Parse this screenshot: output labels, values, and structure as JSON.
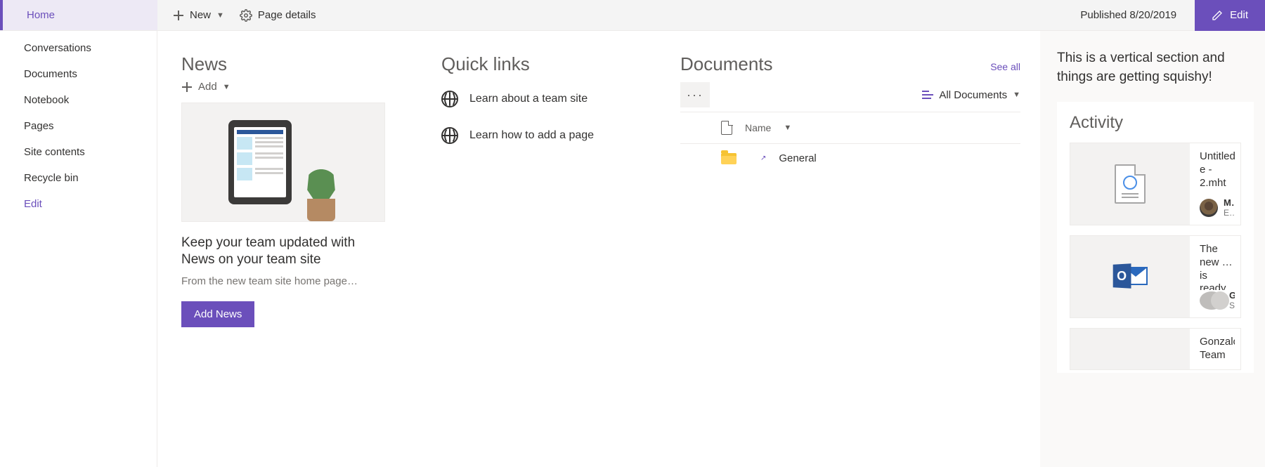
{
  "commandBar": {
    "newLabel": "New",
    "pageDetailsLabel": "Page details",
    "publishedLabel": "Published 8/20/2019",
    "editLabel": "Edit"
  },
  "leftNav": {
    "activeIndex": 0,
    "items": [
      {
        "label": "Home"
      },
      {
        "label": "Conversations"
      },
      {
        "label": "Documents"
      },
      {
        "label": "Notebook"
      },
      {
        "label": "Pages"
      },
      {
        "label": "Site contents"
      },
      {
        "label": "Recycle bin"
      },
      {
        "label": "Edit",
        "isLink": true
      }
    ]
  },
  "news": {
    "title": "News",
    "addLabel": "Add",
    "heroTitle": "Keep your team updated with News on your team site",
    "heroSubtitle": "From the new team site home page…",
    "addNewsButton": "Add News"
  },
  "quickLinks": {
    "title": "Quick links",
    "items": [
      {
        "label": "Learn about a team site"
      },
      {
        "label": "Learn how to add a page"
      }
    ]
  },
  "documents": {
    "title": "Documents",
    "seeAll": "See all",
    "viewName": "All Documents",
    "columnHeader": "Name",
    "rows": [
      {
        "name": "General",
        "type": "folder",
        "shared": true
      }
    ]
  },
  "vertical": {
    "text": "This is a vertical section and things are getting squishy!",
    "activityTitle": "Activity",
    "items": [
      {
        "title": "Untitled… e - 2.mht",
        "user": "Mi…",
        "action": "Edi…",
        "thumb": "webdoc"
      },
      {
        "title": "The new … is ready",
        "user": "Go…",
        "action": "Se…",
        "thumb": "outlook"
      },
      {
        "title": "Gonzalos Team",
        "user": "",
        "action": "",
        "thumb": "none"
      }
    ]
  }
}
